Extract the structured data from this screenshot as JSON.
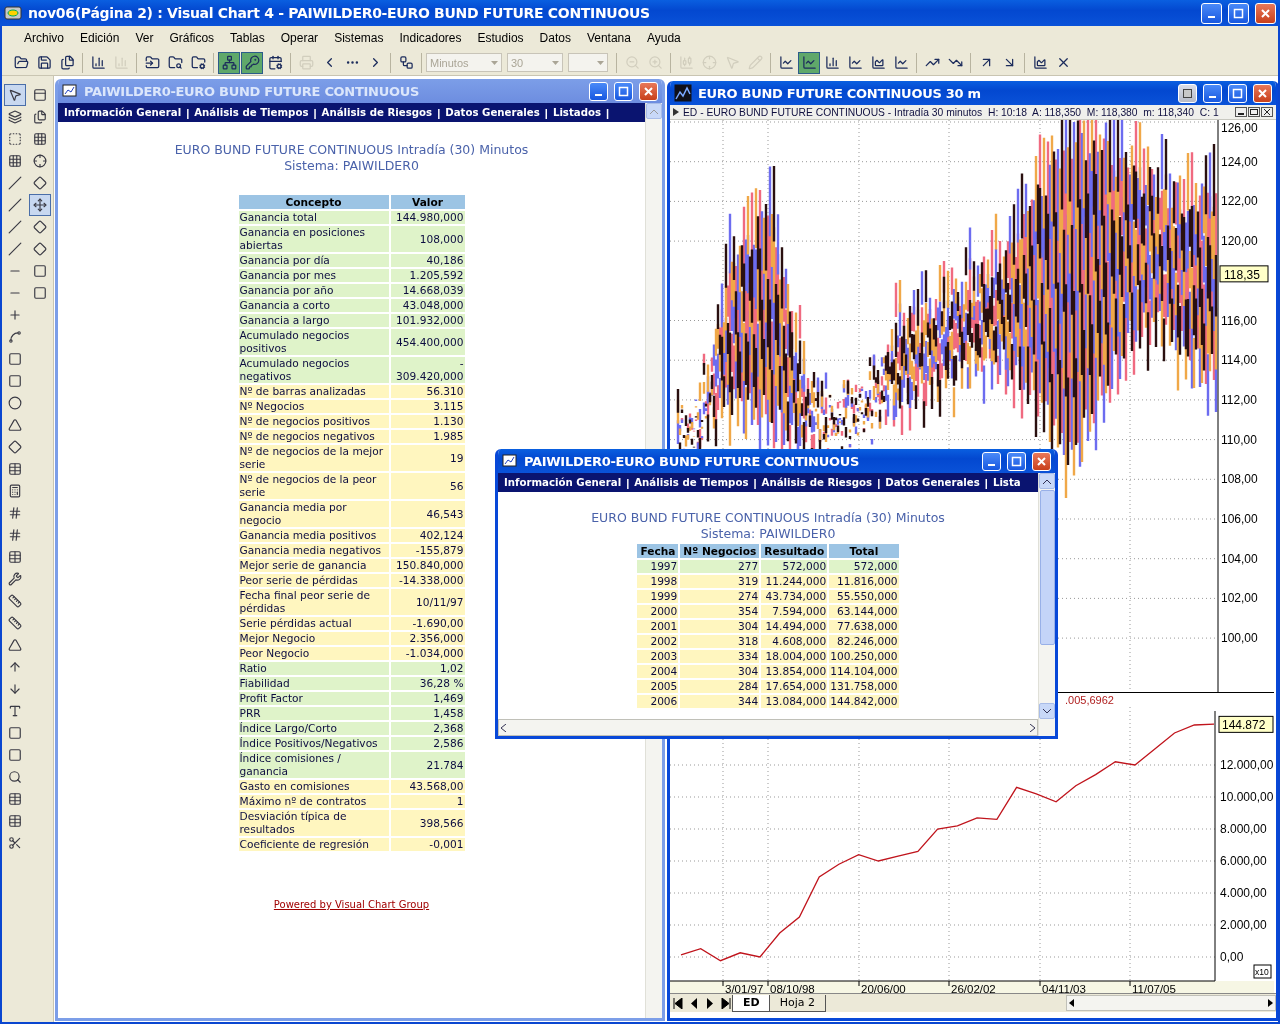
{
  "app_title": "nov06(Página 2) : Visual Chart 4 - PAIWILDER0-EURO BUND FUTURE CONTINUOUS",
  "menu": [
    "Archivo",
    "Edición",
    "Ver",
    "Gráficos",
    "Tablas",
    "Operar",
    "Sistemas",
    "Indicadores",
    "Estudios",
    "Datos",
    "Ventana",
    "Ayuda"
  ],
  "toolbar_left": [
    {
      "pressed": false,
      "disabled": false
    },
    {
      "pressed": false,
      "disabled": false
    },
    {
      "pressed": false,
      "disabled": false
    },
    {
      "pressed": false,
      "disabled": false
    },
    {
      "pressed": false,
      "disabled": true
    },
    {
      "pressed": false,
      "disabled": false
    },
    {
      "pressed": false,
      "disabled": false
    },
    {
      "pressed": false,
      "disabled": false
    },
    {
      "pressed": true,
      "disabled": false
    },
    {
      "pressed": true,
      "disabled": false
    },
    {
      "pressed": false,
      "disabled": false
    },
    {
      "pressed": false,
      "disabled": true
    },
    {
      "pressed": false,
      "disabled": false
    },
    {
      "pressed": false,
      "disabled": false
    },
    {
      "pressed": false,
      "disabled": false
    },
    {
      "pressed": false,
      "disabled": false
    }
  ],
  "combos": [
    {
      "value": "Minutos",
      "disabled": true
    },
    {
      "value": "30",
      "disabled": true
    },
    {
      "disabled": true
    }
  ],
  "toolbar_right": [
    {
      "pressed": false,
      "disabled": true
    },
    {
      "pressed": false,
      "disabled": true
    },
    {
      "pressed": false,
      "disabled": true
    },
    {
      "pressed": false,
      "disabled": true
    },
    {
      "pressed": false,
      "disabled": true
    },
    {
      "pressed": false,
      "disabled": true
    },
    {
      "pressed": false,
      "disabled": false
    },
    {
      "pressed": true,
      "disabled": false
    },
    {
      "pressed": false,
      "disabled": false
    },
    {
      "pressed": false,
      "disabled": false
    },
    {
      "pressed": false,
      "disabled": false
    },
    {
      "pressed": false,
      "disabled": false
    },
    {
      "pressed": false,
      "disabled": false
    },
    {
      "pressed": false,
      "disabled": false
    },
    {
      "pressed": false,
      "disabled": false
    },
    {
      "pressed": false,
      "disabled": false
    },
    {
      "pressed": false,
      "disabled": false
    },
    {
      "pressed": false,
      "disabled": false
    }
  ],
  "side_toolbar": {
    "column_1": [
      {
        "pressed": true
      },
      {
        "pressed": false
      },
      {
        "pressed": false
      },
      {
        "pressed": false
      },
      {
        "pressed": false
      },
      {
        "pressed": false
      },
      {
        "pressed": false
      },
      {
        "pressed": false
      },
      {
        "pressed": false
      },
      {
        "pressed": false
      },
      {
        "pressed": false
      },
      {
        "pressed": false
      },
      {
        "pressed": false
      },
      {
        "pressed": false
      },
      {
        "pressed": false
      },
      {
        "pressed": false
      },
      {
        "pressed": false
      },
      {
        "pressed": false
      },
      {
        "pressed": false
      },
      {
        "pressed": false
      },
      {
        "pressed": false
      },
      {
        "pressed": false
      },
      {
        "pressed": false
      },
      {
        "pressed": false
      },
      {
        "pressed": false
      },
      {
        "pressed": false
      },
      {
        "pressed": false
      },
      {
        "pressed": false
      },
      {
        "pressed": false
      },
      {
        "pressed": false
      },
      {
        "pressed": false
      },
      {
        "pressed": false
      },
      {
        "pressed": false
      },
      {
        "pressed": false
      },
      {
        "pressed": false
      }
    ],
    "column_2": [
      {
        "pressed": false
      },
      {
        "pressed": false
      },
      {
        "pressed": false
      },
      {
        "pressed": false
      },
      {
        "pressed": false
      },
      {
        "pressed": true
      },
      {
        "pressed": false
      },
      {
        "pressed": false
      },
      {
        "pressed": false
      },
      {
        "pressed": false
      }
    ]
  },
  "report_window": {
    "title": "PAIWILDER0-EURO BUND FUTURE CONTINUOUS",
    "active": false,
    "nav": {
      "separator": "|",
      "links": [
        "Información General",
        "Análisis de Tiempos",
        "Análisis de Riesgos",
        "Datos Generales",
        "Listados"
      ]
    },
    "heading": [
      "EURO BUND FUTURE CONTINUOUS Intradía (30) Minutos",
      "Sistema: PAIWILDER0"
    ],
    "columns": [
      "Concepto",
      "Valor"
    ],
    "rows": [
      {
        "concept": "Ganancia total",
        "value": "144.980,000",
        "color": "#dff3c9"
      },
      {
        "concept": "Ganancia en posiciones abiertas",
        "value": "108,000",
        "color": "#dff3c9"
      },
      {
        "concept": "Ganancia por día",
        "value": "40,186",
        "color": "#dff3c9"
      },
      {
        "concept": "Ganancia por mes",
        "value": "1.205,592",
        "color": "#dff3c9"
      },
      {
        "concept": "Ganancia por año",
        "value": "14.668,039",
        "color": "#dff3c9"
      },
      {
        "concept": "Ganancia a corto",
        "value": "43.048,000",
        "color": "#dff3c9"
      },
      {
        "concept": "Ganancia a largo",
        "value": "101.932,000",
        "color": "#dff3c9"
      },
      {
        "concept": "Acumulado negocios positivos",
        "value": "454.400,000",
        "color": "#dff3c9"
      },
      {
        "concept": "Acumulado negocios negativos",
        "value": "- 309.420,000",
        "color": "#dff3c9"
      },
      {
        "concept": "Nº de barras analizadas",
        "value": "56.310",
        "color": "#fff6bf"
      },
      {
        "concept": "Nº Negocios",
        "value": "3.115",
        "color": "#fff6bf"
      },
      {
        "concept": "Nº de negocios positivos",
        "value": "1.130",
        "color": "#fff6bf"
      },
      {
        "concept": "Nº de negocios negativos",
        "value": "1.985",
        "color": "#fff6bf"
      },
      {
        "concept": "Nº de negocios de la mejor serie",
        "value": "19",
        "color": "#fff6bf"
      },
      {
        "concept": "Nº de negocios de la peor serie",
        "value": "56",
        "color": "#fff6bf"
      },
      {
        "concept": "Ganancia media por negocio",
        "value": "46,543",
        "color": "#fff6bf"
      },
      {
        "concept": "Ganancia media positivos",
        "value": "402,124",
        "color": "#fff6bf"
      },
      {
        "concept": "Ganancia media negativos",
        "value": "-155,879",
        "color": "#fff6bf"
      },
      {
        "concept": "Mejor serie de ganancia",
        "value": "150.840,000",
        "color": "#fff6bf"
      },
      {
        "concept": "Peor serie de pérdidas",
        "value": "-14.338,000",
        "color": "#fff6bf"
      },
      {
        "concept": "Fecha final peor serie de pérdidas",
        "value": "10/11/97",
        "color": "#fff6bf"
      },
      {
        "concept": "Serie pérdidas actual",
        "value": "-1.690,00",
        "color": "#fff6bf"
      },
      {
        "concept": "Mejor Negocio",
        "value": "2.356,000",
        "color": "#fff6bf"
      },
      {
        "concept": "Peor Negocio",
        "value": "-1.034,000",
        "color": "#fff6bf"
      },
      {
        "concept": "Ratio",
        "value": "1,02",
        "color": "#dff3c9"
      },
      {
        "concept": "Fiabilidad",
        "value": "36,28 %",
        "color": "#dff3c9"
      },
      {
        "concept": "Profit Factor",
        "value": "1,469",
        "color": "#dff3c9"
      },
      {
        "concept": "PRR",
        "value": "1,458",
        "color": "#dff3c9"
      },
      {
        "concept": "Índice Largo/Corto",
        "value": "2,368",
        "color": "#dff3c9"
      },
      {
        "concept": "Índice Positivos/Negativos",
        "value": "2,586",
        "color": "#dff3c9"
      },
      {
        "concept": "Índice comisiones / ganancia",
        "value": "21.784",
        "color": "#dff3c9"
      },
      {
        "concept": "Gasto en comisiones",
        "value": "43.568,00",
        "color": "#fff6bf"
      },
      {
        "concept": "Máximo nº de contratos",
        "value": "1",
        "color": "#fff6bf"
      },
      {
        "concept": "Desviación típica de resultados",
        "value": "398,566",
        "color": "#fff6bf"
      },
      {
        "concept": "Coeficiente de regresión",
        "value": "-0,001",
        "color": "#fff6bf"
      }
    ],
    "footer_link": "Powered by Visual Chart Group"
  },
  "chart_window": {
    "title": "EURO BUND FUTURE CONTINUOUS 30 m",
    "active": true,
    "info": "ED - EURO BUND FUTURE CONTINUOUS - Intradía 30 minutos  H: 10:18  A: 118,350  M: 118,380  m: 118,340  C: 1",
    "price_axis": [
      "126,00",
      "124,00",
      "122,00",
      "120,00",
      "116,00",
      "114,00",
      "112,00",
      "110,00",
      "108,00",
      "106,00",
      "104,00",
      "102,00",
      "100,00"
    ],
    "price_marker": "118,35",
    "equity_label": ".005,6962",
    "equity_marker": "144.872",
    "scale_note": "x10",
    "date_labels": [
      "3/01/97",
      "08/10/98",
      "20/06/00",
      "26/02/02",
      "04/11/03",
      "11/07/05"
    ],
    "chart_data": {
      "type": "line",
      "grid": true,
      "series": [
        {
          "color": "#c0141c",
          "values": [
            130,
            520,
            -230,
            260,
            0,
            1500,
            2500,
            5000,
            5800,
            6400,
            6000,
            6300,
            6600,
            8000,
            8200,
            8700,
            8600,
            10600,
            10200,
            9700,
            10700,
            11400,
            12200,
            12000,
            13000,
            14000,
            14500,
            14550
          ]
        }
      ],
      "ylim": [
        -1500,
        16500
      ],
      "yticks": [
        {
          "value": 0,
          "label": "0,00"
        },
        {
          "value": 2000,
          "label": "2.000,00"
        },
        {
          "value": 4000,
          "label": "4.000,00"
        },
        {
          "value": 6000,
          "label": "6.000,00"
        },
        {
          "value": 8000,
          "label": "8.000,00"
        },
        {
          "value": 10000,
          "label": "10.000,00"
        },
        {
          "value": 12000,
          "label": "12.000,00"
        }
      ]
    },
    "sheet_tabs": [
      {
        "label": "ED",
        "selected": true
      },
      {
        "label": "Hoja 2",
        "selected": false
      }
    ]
  },
  "listing_window": {
    "title": "PAIWILDER0-EURO BUND FUTURE CONTINUOUS",
    "active": true,
    "nav": {
      "separator": "|",
      "links": [
        "Información General",
        "Análisis de Tiempos",
        "Análisis de Riesgos",
        "Datos Generales",
        "Lista"
      ]
    },
    "heading": [
      "EURO BUND FUTURE CONTINUOUS Intradía (30) Minutos",
      "Sistema: PAIWILDER0"
    ],
    "columns": [
      "Fecha",
      "Nº Negocios",
      "Resultado",
      "Total"
    ],
    "rows": [
      {
        "cells": [
          "1997",
          "277",
          "572,000",
          "572,000"
        ],
        "color": "#dff3c9"
      },
      {
        "cells": [
          "1998",
          "319",
          "11.244,000",
          "11.816,000"
        ],
        "color": "#fff6bf"
      },
      {
        "cells": [
          "1999",
          "274",
          "43.734,000",
          "55.550,000"
        ],
        "color": "#fff6bf"
      },
      {
        "cells": [
          "2000",
          "354",
          "7.594,000",
          "63.144,000"
        ],
        "color": "#fff6bf"
      },
      {
        "cells": [
          "2001",
          "304",
          "14.494,000",
          "77.638,000"
        ],
        "color": "#fff6bf"
      },
      {
        "cells": [
          "2002",
          "318",
          "4.608,000",
          "82.246,000"
        ],
        "color": "#fff6bf"
      },
      {
        "cells": [
          "2003",
          "334",
          "18.004,000",
          "100.250,000"
        ],
        "color": "#fff6bf"
      },
      {
        "cells": [
          "2004",
          "304",
          "13.854,000",
          "114.104,000"
        ],
        "color": "#fff6bf"
      },
      {
        "cells": [
          "2005",
          "284",
          "17.654,000",
          "131.758,000"
        ],
        "color": "#fff6bf"
      },
      {
        "cells": [
          "2006",
          "344",
          "13.084,000",
          "144.842,000"
        ],
        "color": "#fff6bf"
      }
    ]
  }
}
